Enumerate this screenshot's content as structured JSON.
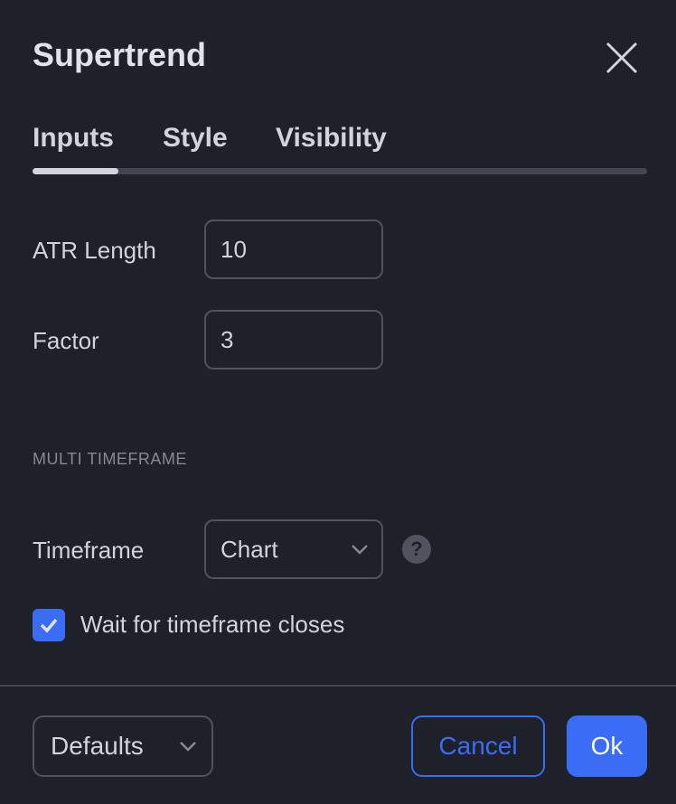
{
  "dialog": {
    "title": "Supertrend"
  },
  "tabs": [
    {
      "label": "Inputs",
      "active": true
    },
    {
      "label": "Style"
    },
    {
      "label": "Visibility"
    }
  ],
  "inputs": {
    "atr_length": {
      "label": "ATR Length",
      "value": "10"
    },
    "factor": {
      "label": "Factor",
      "value": "3"
    }
  },
  "section": {
    "title": "MULTI TIMEFRAME"
  },
  "timeframe": {
    "label": "Timeframe",
    "value": "Chart",
    "help": "?"
  },
  "wait_checkbox": {
    "label": "Wait for timeframe closes",
    "checked": true
  },
  "footer": {
    "defaults": "Defaults",
    "cancel": "Cancel",
    "ok": "Ok"
  },
  "colors": {
    "accent": "#3b6cf6",
    "background": "#1e202a",
    "border": "#50535e"
  }
}
